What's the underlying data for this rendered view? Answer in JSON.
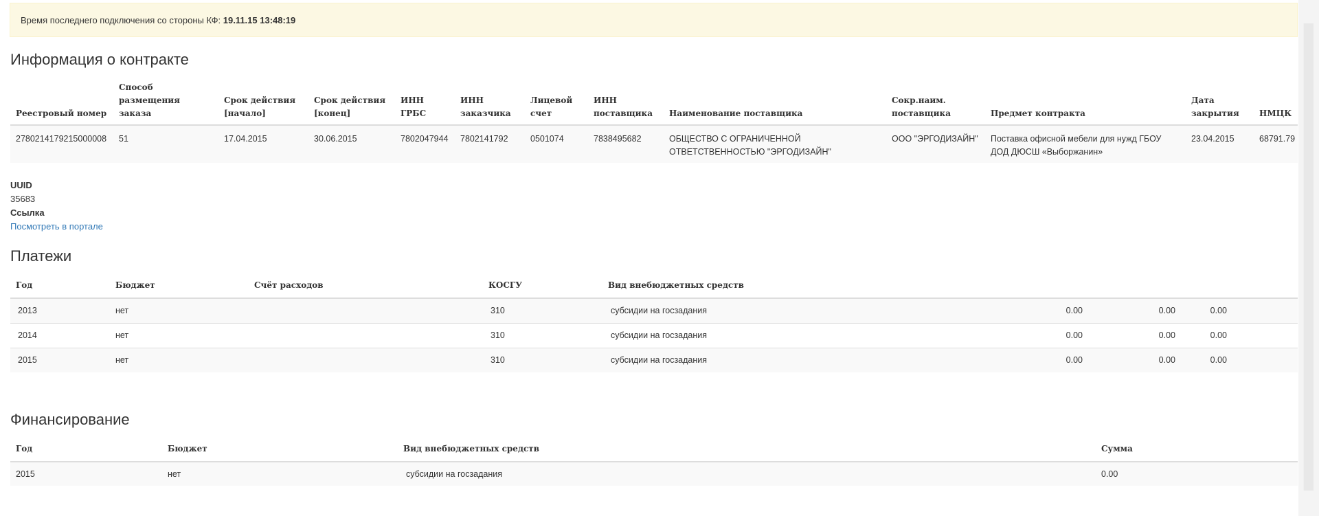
{
  "alert": {
    "text": "Время последнего подключения со стороны КФ:",
    "time": "19.11.15 13:48:19"
  },
  "contract": {
    "title": "Информация о контракте",
    "columns": [
      "Реестровый номер",
      "Способ размещения заказа",
      "Срок действия [начало]",
      "Срок действия [конец]",
      "ИНН ГРБС",
      "ИНН заказчика",
      "Лицевой счет",
      "ИНН поставщика",
      "Наименование поставщика",
      "Сокр.наим. поставщика",
      "Предмет контракта",
      "Дата закрытия",
      "НМЦК"
    ],
    "row": [
      "2780214179215000008",
      "51",
      "17.04.2015",
      "30.06.2015",
      "7802047944",
      "7802141792",
      "0501074",
      "7838495682",
      "ОБЩЕСТВО С ОГРАНИЧЕННОЙ ОТВЕТСТВЕННОСТЬЮ \"ЭРГОДИЗАЙН\"",
      "ООО \"ЭРГОДИЗАЙН\"",
      "Поставка офисной мебели для нужд ГБОУ ДОД ДЮСШ «Выборжанин»",
      "23.04.2015",
      "68791.79"
    ]
  },
  "meta": {
    "uuid_label": "UUID",
    "uuid_value": "35683",
    "link_label": "Ссылка",
    "link_text": "Посмотреть в портале"
  },
  "payments": {
    "title": "Платежи",
    "columns": [
      "Год",
      "Бюджет",
      "Счёт расходов",
      "КОСГУ",
      "Вид внебюджетных средств",
      "",
      "",
      ""
    ],
    "rows": [
      [
        "2013",
        "нет",
        "",
        "310",
        "субсидии на госзадания",
        "0.00",
        "0.00",
        "0.00"
      ],
      [
        "2014",
        "нет",
        "",
        "310",
        "субсидии на госзадания",
        "0.00",
        "0.00",
        "0.00"
      ],
      [
        "2015",
        "нет",
        "",
        "310",
        "субсидии на госзадания",
        "0.00",
        "0.00",
        "0.00"
      ]
    ]
  },
  "financing": {
    "title": "Финансирование",
    "columns": [
      "Год",
      "Бюджет",
      "Вид внебюджетных средств",
      "Сумма"
    ],
    "rows": [
      [
        "2015",
        "нет",
        "субсидии на госзадания",
        "0.00"
      ]
    ]
  }
}
